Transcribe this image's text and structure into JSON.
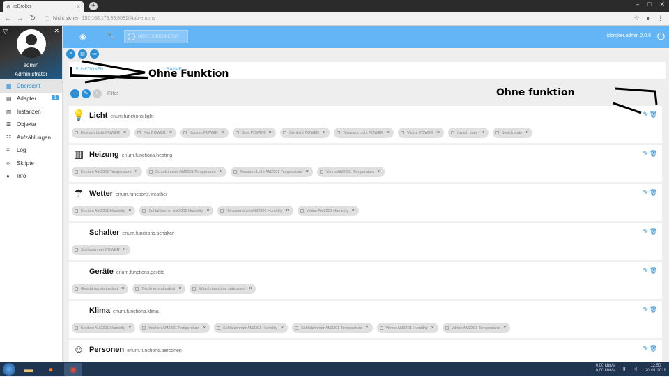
{
  "browser": {
    "tab_title": "ioBroker",
    "new_tab_label": "+",
    "secure_label": "Nicht sicher",
    "url": "192.168.178.39:8081/#tab-enums"
  },
  "sidebar": {
    "user_name": "admin",
    "user_role": "Administrator",
    "items": [
      {
        "label": "Übersicht",
        "icon": "dashboard-icon"
      },
      {
        "label": "Adapter",
        "icon": "store-icon",
        "badge": "1"
      },
      {
        "label": "Instanzen",
        "icon": "instances-icon"
      },
      {
        "label": "Objekte",
        "icon": "objects-icon"
      },
      {
        "label": "Aufzählungen",
        "icon": "list-icon"
      },
      {
        "label": "Log",
        "icon": "log-icon"
      },
      {
        "label": "Skripte",
        "icon": "code-icon"
      },
      {
        "label": "Info",
        "icon": "info-icon"
      }
    ]
  },
  "topbar": {
    "host_label": "HOST: IOBROKER-PI",
    "user_label": "iobroker.admin 2.0.8"
  },
  "tabs": {
    "tab1": "FUNKTIONEN",
    "tab2": "RÄUME"
  },
  "toolbar": {
    "filter_placeholder": "Filter"
  },
  "annotations": {
    "first": "Ohne Funktion",
    "second": "Ohne funktion"
  },
  "enums": [
    {
      "name": "Licht",
      "id": "enum.functions.light",
      "icon": "bulb-icon",
      "members": [
        "Esstisch Licht POWER",
        "Flur POWER",
        "Kochen POWER",
        "Sofa POWER",
        "Stehlicht POWER",
        "Terassen Licht POWER",
        "Vitrine POWER",
        "Switch state",
        "Switch state"
      ]
    },
    {
      "name": "Heizung",
      "id": "enum.functions.heating",
      "icon": "radiator-icon",
      "members": [
        "Kochen AM2301 Temperature",
        "Schlafzimmer AM2301 Temperature",
        "Terassen Licht AM2301 Temperature",
        "Vitrine AM2301 Temperature"
      ]
    },
    {
      "name": "Wetter",
      "id": "enum.functions.weather",
      "icon": "umbrella-icon",
      "members": [
        "Kochen AM2301 Humidity",
        "Schlafzimmer AM2301 Humidity",
        "Terassen Licht AM2301 Humidity",
        "Vitrine AM2301 Humidity"
      ]
    },
    {
      "name": "Schalter",
      "id": "enum.functions.schalter",
      "icon": "",
      "members": [
        "Schlafzimmer POWER"
      ]
    },
    {
      "name": "Geräte",
      "id": "enum.functions.geräte",
      "icon": "",
      "members": [
        "Geschirrsp statusdest",
        "Trockner statusdest",
        "Waschmaschine statusdest"
      ]
    },
    {
      "name": "Klima",
      "id": "enum.functions.klima",
      "icon": "",
      "members": [
        "Kochen AM2301 Humidity",
        "Kochen AM2301 Temperature",
        "Schlafzimmer AM2301 Humidity",
        "Schlafzimmer AM2301 Temperature",
        "Vitrine AM2301 Humidity",
        "Vitrine AM2301 Temperature"
      ]
    },
    {
      "name": "Personen",
      "id": "enum.functions.personen",
      "icon": "person-icon",
      "members": []
    }
  ],
  "taskbar": {
    "time": "12:50",
    "date": "20.01.2019",
    "net_up": "0,00 kbit/s",
    "net_down": "0,00 kbit/s"
  }
}
